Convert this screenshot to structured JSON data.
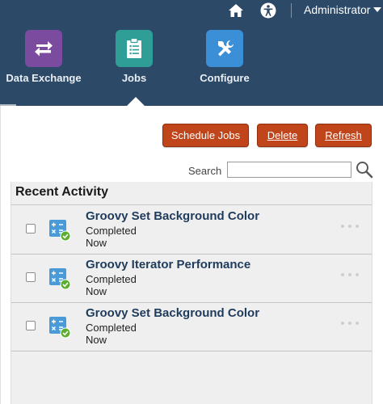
{
  "topbar": {
    "home_icon": "home-icon",
    "accessibility_icon": "accessibility-icon",
    "user_label": "Administrator"
  },
  "nav": {
    "items": [
      {
        "label": "Data Exchange",
        "icon": "swap-arrows-icon",
        "color": "#7a4b9e"
      },
      {
        "label": "Jobs",
        "icon": "clipboard-icon",
        "color": "#2f9e96"
      },
      {
        "label": "Configure",
        "icon": "wrench-hammer-icon",
        "color": "#3b8fd6"
      }
    ],
    "active": "Jobs"
  },
  "toolbar": {
    "schedule_label": "Schedule Jobs",
    "delete_label": "Delete",
    "refresh_label": "Refresh"
  },
  "search": {
    "label": "Search",
    "value": ""
  },
  "activity": {
    "title": "Recent Activity",
    "rows": [
      {
        "name": "Groovy Set Background Color",
        "status": "Completed",
        "time": "Now"
      },
      {
        "name": "Groovy Iterator Performance",
        "status": "Completed",
        "time": "Now"
      },
      {
        "name": "Groovy Set Background Color",
        "status": "Completed",
        "time": "Now"
      }
    ]
  },
  "colors": {
    "header_bg": "#2c4967",
    "button_bg": "#c0451a",
    "job_title": "#1f3b5c",
    "status_ok": "#5cae2e"
  }
}
